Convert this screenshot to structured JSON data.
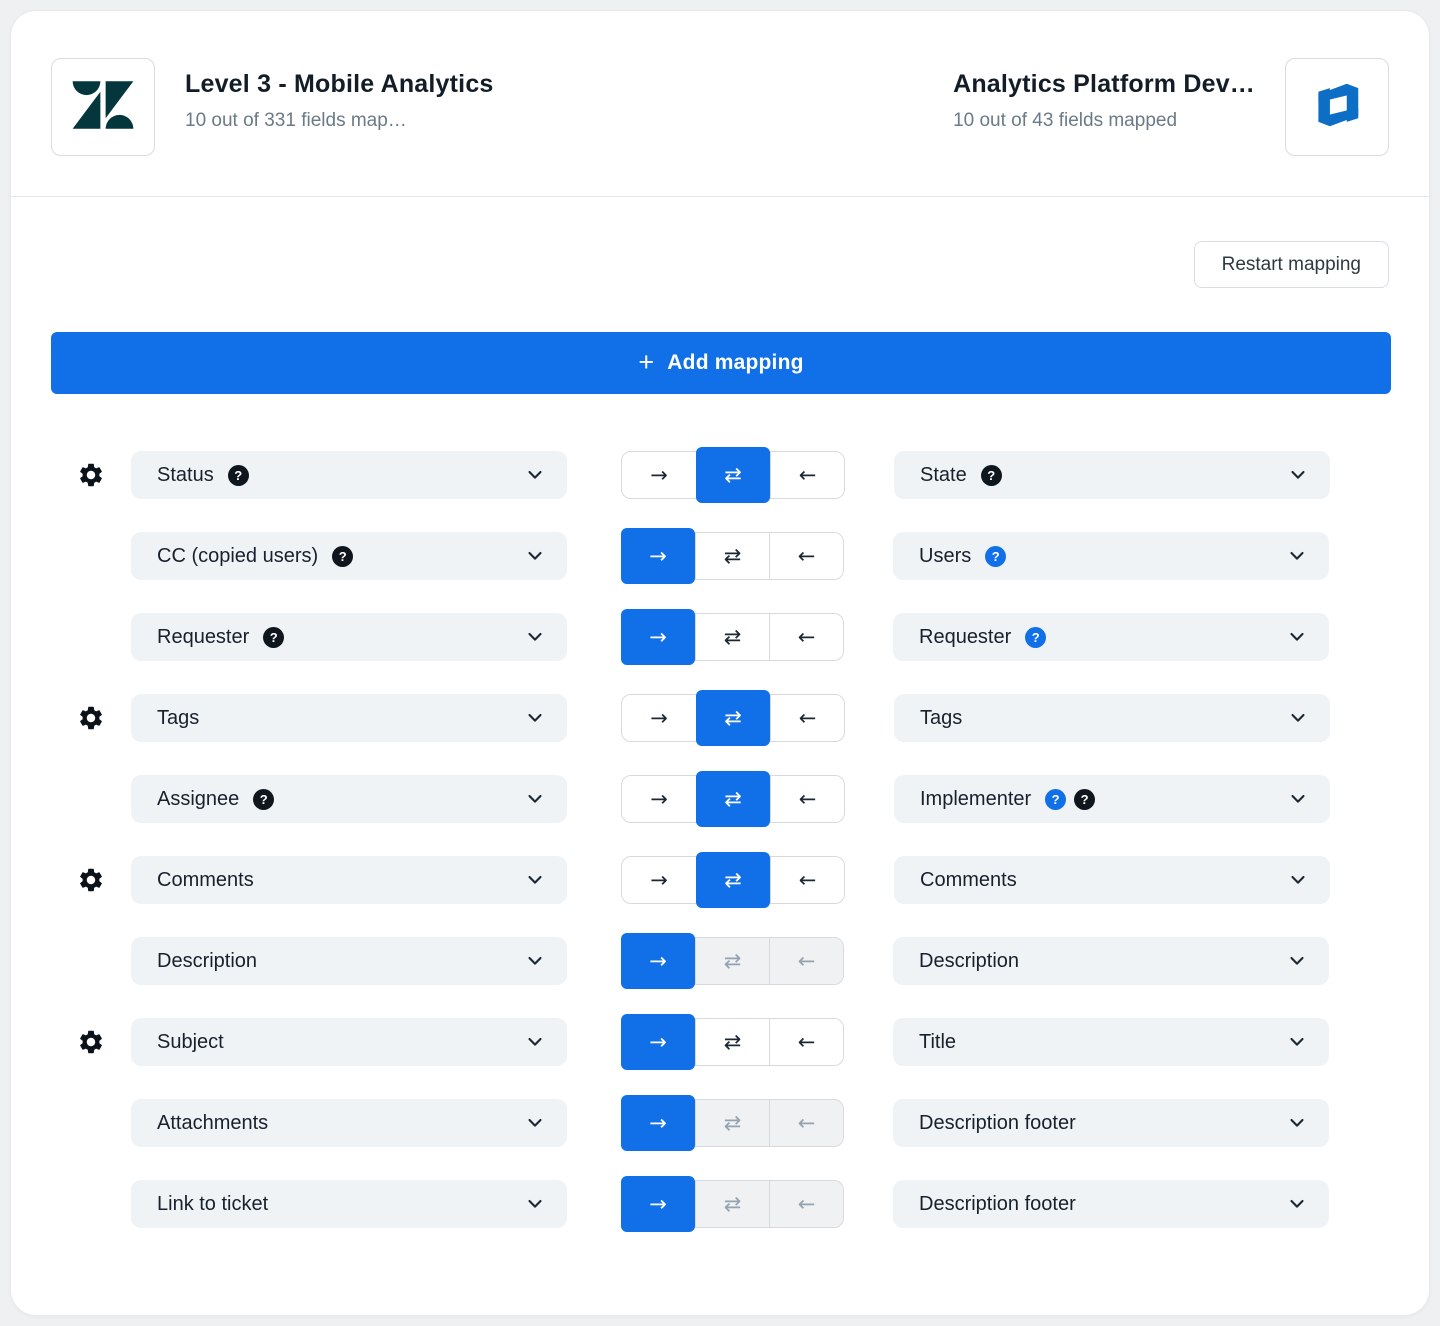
{
  "colors": {
    "accent": "#1170e8",
    "zendesk_dark": "#03363d",
    "azure_devops_blue": "#0d6ec6"
  },
  "header": {
    "source": {
      "logo_name": "zendesk-logo",
      "title": "Level 3 - Mobile Analytics",
      "subtitle": "10 out of 331 fields map…"
    },
    "target": {
      "logo_name": "azure-devops-logo",
      "title": "Analytics Platform Dev…",
      "subtitle": "10 out of 43 fields mapped"
    }
  },
  "toolbar": {
    "restart_label": "Restart mapping",
    "add_label": "Add mapping",
    "plus_icon": "+"
  },
  "toggle_icons": {
    "right": "→",
    "both": "⇄",
    "left": "←"
  },
  "badge_glyph": "?",
  "rows": [
    {
      "has_gear": true,
      "left": {
        "label": "Status",
        "badges": [
          "dark"
        ]
      },
      "direction": "both",
      "others_disabled": false,
      "right": {
        "label": "State",
        "badges": [
          "dark"
        ]
      }
    },
    {
      "has_gear": false,
      "left": {
        "label": "CC (copied users)",
        "badges": [
          "dark"
        ]
      },
      "direction": "right",
      "others_disabled": false,
      "right": {
        "label": "Users",
        "badges": [
          "blue"
        ]
      }
    },
    {
      "has_gear": false,
      "left": {
        "label": "Requester",
        "badges": [
          "dark"
        ]
      },
      "direction": "right",
      "others_disabled": false,
      "right": {
        "label": "Requester",
        "badges": [
          "blue"
        ]
      }
    },
    {
      "has_gear": true,
      "left": {
        "label": "Tags",
        "badges": []
      },
      "direction": "both",
      "others_disabled": false,
      "right": {
        "label": "Tags",
        "badges": []
      }
    },
    {
      "has_gear": false,
      "left": {
        "label": "Assignee",
        "badges": [
          "dark"
        ]
      },
      "direction": "both",
      "others_disabled": false,
      "right": {
        "label": "Implementer",
        "badges": [
          "blue",
          "dark"
        ]
      }
    },
    {
      "has_gear": true,
      "left": {
        "label": "Comments",
        "badges": []
      },
      "direction": "both",
      "others_disabled": false,
      "right": {
        "label": "Comments",
        "badges": []
      }
    },
    {
      "has_gear": false,
      "left": {
        "label": "Description",
        "badges": []
      },
      "direction": "right",
      "others_disabled": true,
      "right": {
        "label": "Description",
        "badges": []
      }
    },
    {
      "has_gear": true,
      "left": {
        "label": "Subject",
        "badges": []
      },
      "direction": "right",
      "others_disabled": false,
      "right": {
        "label": "Title",
        "badges": []
      }
    },
    {
      "has_gear": false,
      "left": {
        "label": "Attachments",
        "badges": []
      },
      "direction": "right",
      "others_disabled": true,
      "right": {
        "label": "Description footer",
        "badges": []
      }
    },
    {
      "has_gear": false,
      "left": {
        "label": "Link to ticket",
        "badges": []
      },
      "direction": "right",
      "others_disabled": true,
      "right": {
        "label": "Description footer",
        "badges": []
      }
    }
  ]
}
